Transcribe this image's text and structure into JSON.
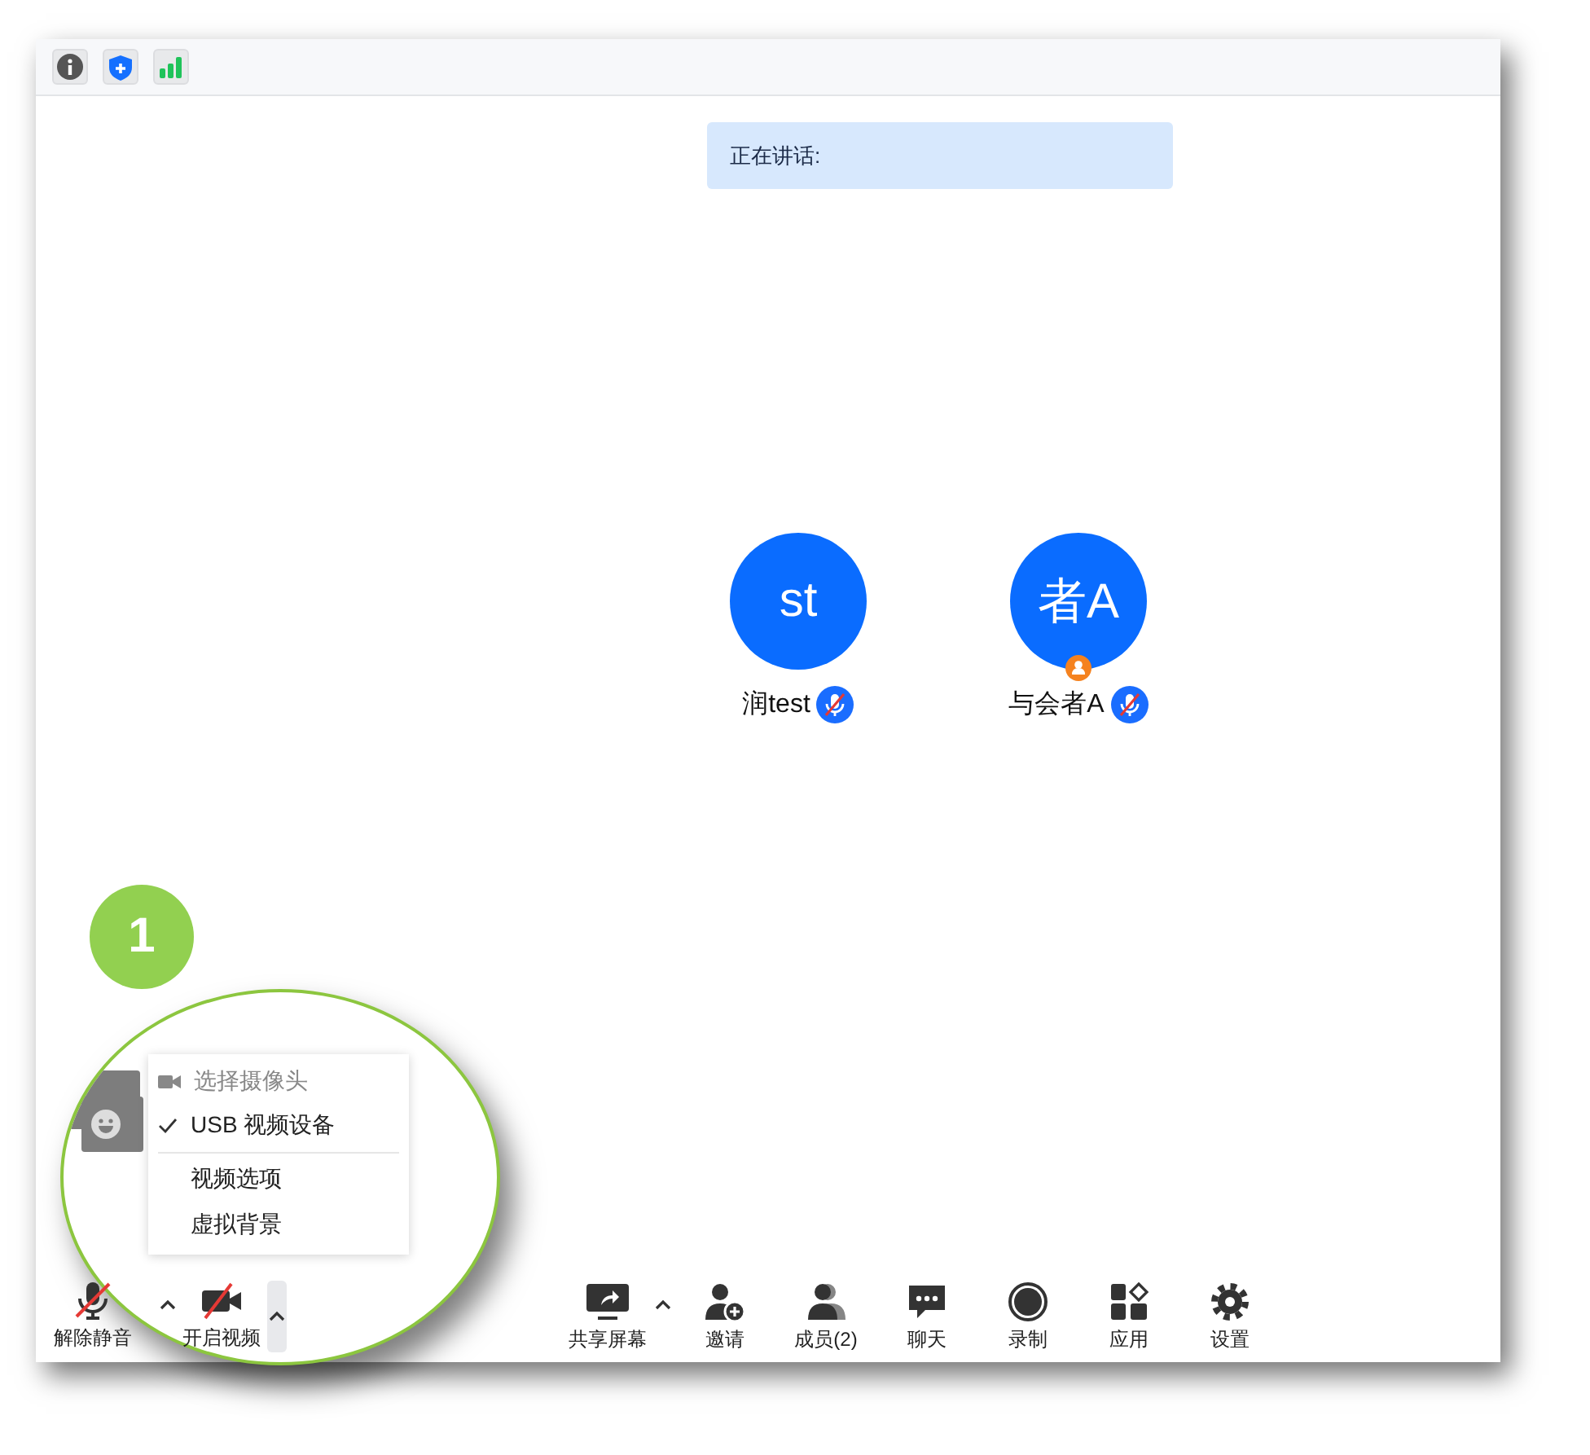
{
  "speaking_banner": {
    "label": "正在讲话:"
  },
  "participants": [
    {
      "initials": "st",
      "name": "润test",
      "muted": true,
      "host_badge": false
    },
    {
      "initials": "者A",
      "name": "与会者A",
      "muted": true,
      "host_badge": true
    }
  ],
  "step_badge": "1",
  "camera_menu": {
    "header": "选择摄像头",
    "devices": [
      {
        "label": "USB 视频设备",
        "checked": true
      }
    ],
    "options": [
      "视频选项",
      "虚拟背景"
    ]
  },
  "toolbar_left": [
    {
      "kind": "mic",
      "label": "解除静音",
      "off": true,
      "caret": true
    },
    {
      "kind": "video",
      "label": "开启视频",
      "off": true,
      "caret": true
    }
  ],
  "toolbar": [
    {
      "kind": "share",
      "label": "共享屏幕",
      "caret": true
    },
    {
      "kind": "invite",
      "label": "邀请",
      "caret": false
    },
    {
      "kind": "members",
      "label": "成员(2)",
      "caret": false
    },
    {
      "kind": "chat",
      "label": "聊天",
      "caret": false
    },
    {
      "kind": "record",
      "label": "录制",
      "caret": false
    },
    {
      "kind": "apps",
      "label": "应用",
      "caret": false
    },
    {
      "kind": "settings",
      "label": "设置",
      "caret": false
    }
  ]
}
